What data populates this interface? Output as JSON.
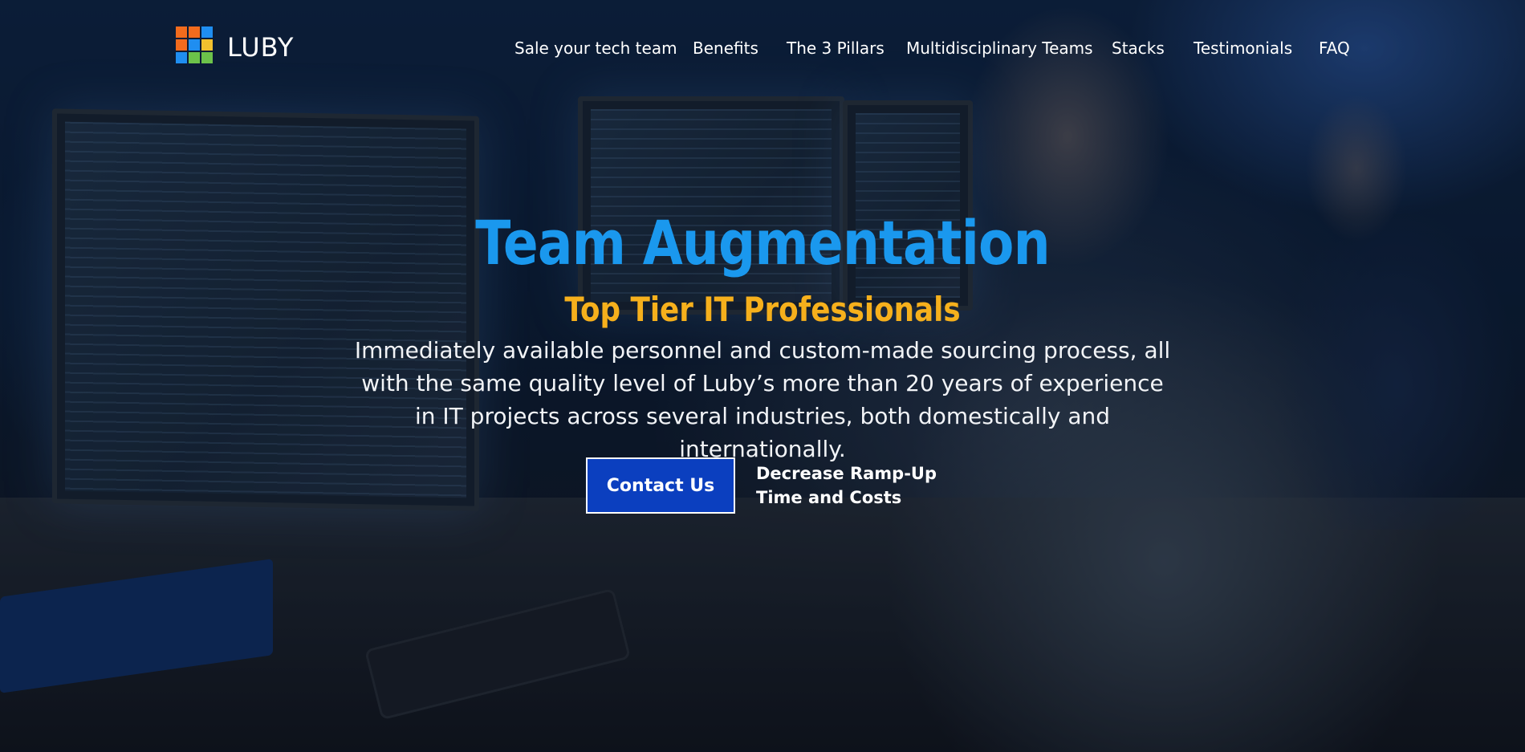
{
  "brand": {
    "name": "LUBY",
    "logo_colors": [
      "#f26b1d",
      "#1f8ef1",
      "#6cc24a",
      "#f2c12e"
    ]
  },
  "nav": {
    "items": [
      {
        "label": "Sale your tech team"
      },
      {
        "label": "Benefits"
      },
      {
        "label": "The 3 Pillars"
      },
      {
        "label": "Multidisciplinary Teams"
      },
      {
        "label": "Stacks"
      },
      {
        "label": "Testimonials"
      },
      {
        "label": "FAQ"
      }
    ]
  },
  "hero": {
    "title": "Team Augmentation",
    "subtitle": "Top Tier IT Professionals",
    "description": "Immediately available personnel and custom-made sourcing process, all with the same quality level of Luby’s more than 20 years of experience in IT projects across several industries, both domestically and internationally.",
    "cta_label": "Contact Us",
    "cta_note": "Decrease Ramp-Up Time and Costs"
  },
  "colors": {
    "title": "#1a98ee",
    "subtitle": "#f6b01c",
    "button": "#0b3fbf"
  }
}
